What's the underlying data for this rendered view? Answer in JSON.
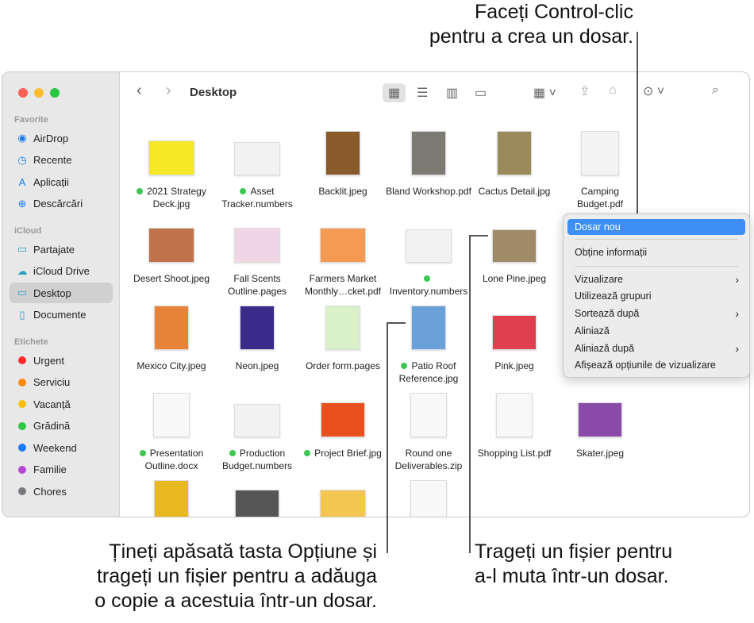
{
  "annotations": {
    "top": [
      "Faceți Control-clic",
      "pentru a crea un dosar."
    ],
    "bottom_left": [
      "Țineți apăsată tasta Opțiune și",
      "trageți un fișier pentru a adăuga",
      "o copie a acestuia într-un dosar."
    ],
    "bottom_right": [
      "Trageți un fișier pentru",
      "a-l muta într-un dosar."
    ]
  },
  "window": {
    "title": "Desktop",
    "traffic": [
      "#fe5f57",
      "#febc2e",
      "#28c840"
    ]
  },
  "sidebar": {
    "sections": [
      {
        "label": "Favorite",
        "items": [
          {
            "label": "AirDrop",
            "icon": "airdrop-icon",
            "glyph": "◉"
          },
          {
            "label": "Recente",
            "icon": "clock-icon",
            "glyph": "◷"
          },
          {
            "label": "Aplicații",
            "icon": "applications-icon",
            "glyph": "A"
          },
          {
            "label": "Descărcări",
            "icon": "download-icon",
            "glyph": "⊕"
          }
        ]
      },
      {
        "label": "iCloud",
        "items": [
          {
            "label": "Partajate",
            "icon": "shared-folder-icon",
            "glyph": "▭"
          },
          {
            "label": "iCloud Drive",
            "icon": "cloud-icon",
            "glyph": "☁"
          },
          {
            "label": "Desktop",
            "icon": "desktop-icon",
            "glyph": "▭",
            "selected": true
          },
          {
            "label": "Documente",
            "icon": "document-icon",
            "glyph": "▯"
          }
        ]
      },
      {
        "label": "Etichete",
        "items": [
          {
            "label": "Urgent",
            "color": "#fe2d2d"
          },
          {
            "label": "Serviciu",
            "color": "#fe8a0a"
          },
          {
            "label": "Vacanță",
            "color": "#f7be0f"
          },
          {
            "label": "Grădină",
            "color": "#2ec940"
          },
          {
            "label": "Weekend",
            "color": "#1a7cf5"
          },
          {
            "label": "Familie",
            "color": "#b548d5"
          },
          {
            "label": "Chores",
            "color": "#7a7a7e"
          }
        ]
      }
    ]
  },
  "files": [
    {
      "name": "2021 Strategy Deck.jpg",
      "tag": true,
      "thumb": "#f5e826",
      "w": 58,
      "h": 44
    },
    {
      "name": "Asset Tracker.numbers",
      "tag": true,
      "thumb": "#f2f2f2",
      "w": 58,
      "h": 42
    },
    {
      "name": "Backlit.jpeg",
      "thumb": "#8a5a2a",
      "w": 44,
      "h": 56
    },
    {
      "name": "Bland Workshop.pdf",
      "thumb": "#7d7a74",
      "w": 44,
      "h": 56
    },
    {
      "name": "Cactus Detail.jpg",
      "thumb": "#9a8a5a",
      "w": 44,
      "h": 56
    },
    {
      "name": "Camping Budget.pdf",
      "thumb": "#f4f4f4",
      "w": 48,
      "h": 56
    },
    {
      "name": "Desert Shoot.jpeg",
      "thumb": "#c0724a",
      "w": 58,
      "h": 44
    },
    {
      "name": "Fall Scents Outline.pages",
      "thumb": "#f0d5e5",
      "w": 58,
      "h": 44
    },
    {
      "name": "Farmers Market Monthly…cket.pdf",
      "thumb": "#f59a52",
      "w": 58,
      "h": 44
    },
    {
      "name": "Inventory.numbers",
      "tag": true,
      "thumb": "#f2f2f2",
      "w": 58,
      "h": 42
    },
    {
      "name": "Lone Pine.jpeg",
      "thumb": "#a08a68",
      "w": 56,
      "h": 42
    },
    null,
    {
      "name": "Mexico City.jpeg",
      "thumb": "#e8843a",
      "w": 44,
      "h": 56
    },
    {
      "name": "Neon.jpeg",
      "thumb": "#3a2a8a",
      "w": 44,
      "h": 56
    },
    {
      "name": "Order form.pages",
      "thumb": "#d9f0c8",
      "w": 44,
      "h": 56
    },
    {
      "name": "Patio Roof Reference.jpg",
      "tag": true,
      "thumb": "#6aa0d8",
      "w": 44,
      "h": 56
    },
    {
      "name": "Pink.jpeg",
      "thumb": "#e0404e",
      "w": 56,
      "h": 44
    },
    null,
    {
      "name": "Presentation Outline.docx",
      "tag": true,
      "thumb": "#f8f8f8",
      "w": 46,
      "h": 56
    },
    {
      "name": "Production Budget.numbers",
      "tag": true,
      "thumb": "#f2f2f2",
      "w": 58,
      "h": 42
    },
    {
      "name": "Project Brief.jpg",
      "tag": true,
      "thumb": "#e8501e",
      "w": 56,
      "h": 44
    },
    {
      "name": "Round one Deliverables.zip",
      "thumb": "#f8f8f8",
      "w": 46,
      "h": 56
    },
    {
      "name": "Shopping List.pdf",
      "thumb": "#f8f8f8",
      "w": 46,
      "h": 56
    },
    {
      "name": "Skater.jpeg",
      "thumb": "#8a4aa8",
      "w": 56,
      "h": 44
    },
    {
      "name": "",
      "thumb": "#e8b820",
      "w": 44,
      "h": 56
    },
    {
      "name": "",
      "thumb": "#555555",
      "w": 56,
      "h": 44
    },
    {
      "name": "",
      "thumb": "#f2c650",
      "w": 58,
      "h": 44
    },
    {
      "name": "",
      "thumb": "#f8f8f8",
      "w": 46,
      "h": 56
    }
  ],
  "context_menu": {
    "items": [
      {
        "label": "Dosar nou",
        "highlight": true
      },
      {
        "sep": true
      },
      {
        "label": "Obține informații"
      },
      {
        "sep": true
      },
      {
        "label": "Vizualizare",
        "submenu": true
      },
      {
        "label": "Utilizează grupuri"
      },
      {
        "label": "Sortează după",
        "submenu": true
      },
      {
        "label": "Aliniază"
      },
      {
        "label": "Aliniază după",
        "submenu": true
      },
      {
        "label": "Afișează opțiunile de vizualizare"
      }
    ]
  }
}
